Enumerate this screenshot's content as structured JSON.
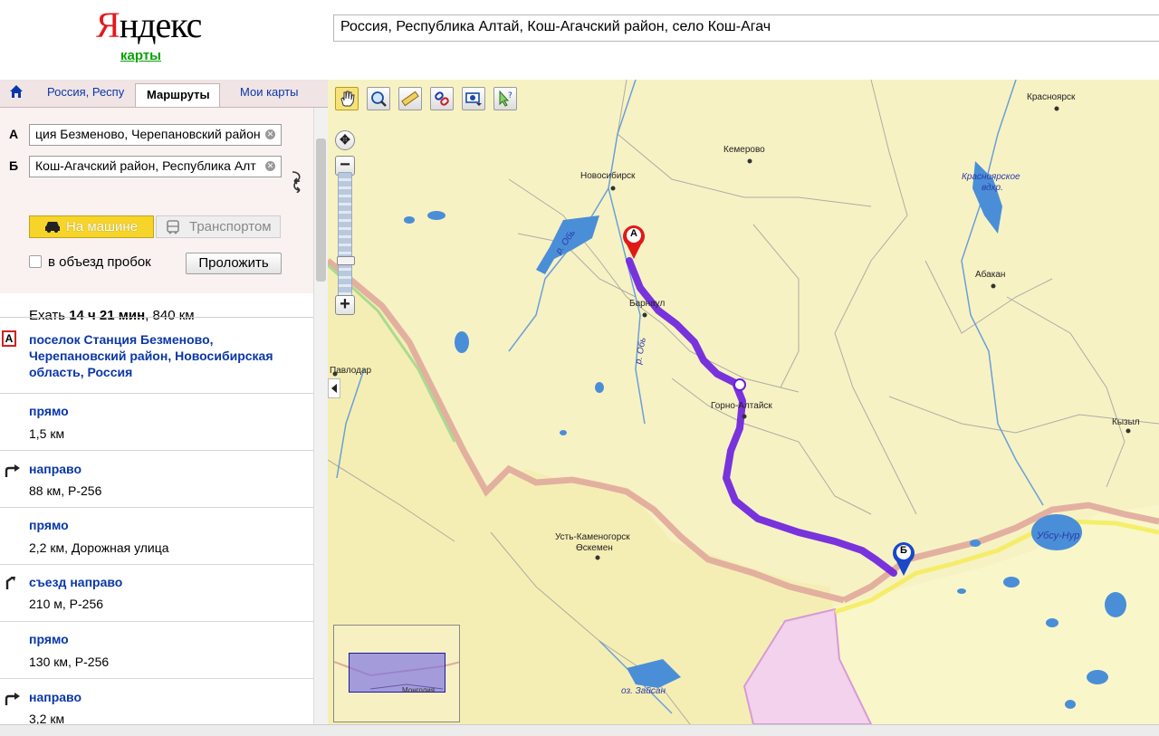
{
  "header": {
    "logo_first": "Я",
    "logo_rest": "ндекс",
    "logo_sub": "карты",
    "search_value": "Россия, Республика Алтай, Кош-Агачский район, село Кош-Агач"
  },
  "tabs": [
    {
      "label": "Россия, Респу"
    },
    {
      "label": "Маршруты"
    },
    {
      "label": "Мои карты"
    }
  ],
  "route_form": {
    "from_label": "А",
    "from_value": "ция Безменово, Черепановский район",
    "to_label": "Б",
    "to_value": "Кош-Агачский район, Республика Алт",
    "mode_car": "На машине",
    "mode_transport": "Транспортом",
    "avoid_traffic_label": "в объезд пробок",
    "avoid_traffic_checked": false,
    "build_button": "Проложить"
  },
  "summary": {
    "prefix": "Ехать ",
    "duration": "14 ч 21 мин",
    "distance": ", 840 км"
  },
  "steps": {
    "start": {
      "badge": "А",
      "title": "поселок Станция Безменово, Черепановский район, Новосибирская область, Россия"
    },
    "items": [
      {
        "title": "прямо",
        "detail": "1,5 км",
        "icon": "none"
      },
      {
        "title": "направо",
        "detail": "88 км, Р-256",
        "icon": "turn-right-icon"
      },
      {
        "title": "прямо",
        "detail": "2,2 км, Дорожная улица",
        "icon": "none"
      },
      {
        "title": "съезд направо",
        "detail": "210 м, Р-256",
        "icon": "exit-right-icon"
      },
      {
        "title": "прямо",
        "detail": "130 км, Р-256",
        "icon": "none"
      },
      {
        "title": "направо",
        "detail": "3,2 км",
        "icon": "turn-right-icon"
      }
    ]
  },
  "map": {
    "marker_a": "А",
    "marker_b": "Б",
    "route_color": "#6a1ee0",
    "cities": [
      {
        "name": "Красноярск"
      },
      {
        "name": "Кемерово"
      },
      {
        "name": "Новосибирск"
      },
      {
        "name": "Абакан"
      },
      {
        "name": "Барнаул"
      },
      {
        "name": "Горно-Алтайск"
      },
      {
        "name": "Кызыл"
      },
      {
        "name": "Усть-Каменогорск"
      },
      {
        "name": "Өскемен"
      },
      {
        "name": "Павлодар"
      },
      {
        "name": "Убсу-Нур"
      }
    ],
    "rivers": [
      {
        "name": "р. Обь"
      },
      {
        "name": "р. Обь"
      },
      {
        "name": "Красноярское"
      },
      {
        "name": "вдхр."
      },
      {
        "name": "оз. Зайсан"
      }
    ],
    "minimap_label": "Монголия"
  }
}
